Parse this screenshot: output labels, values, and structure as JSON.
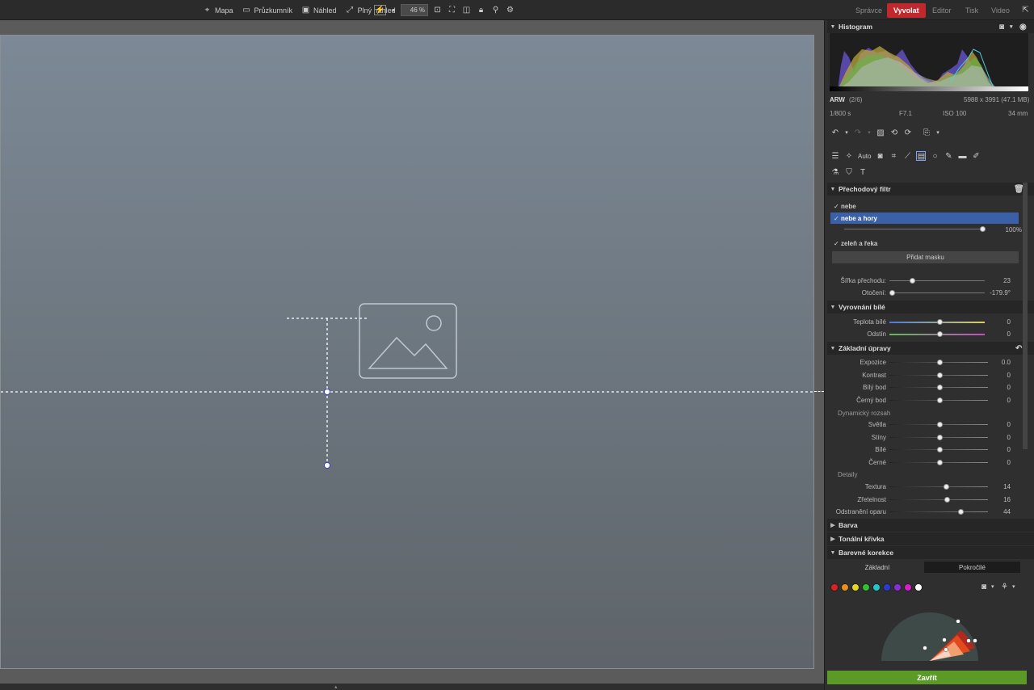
{
  "topbar": {
    "map": "Mapa",
    "browser": "Průzkumník",
    "preview": "Náhled",
    "fullscreen": "Plný náhled",
    "zoom": "46 %",
    "modules": [
      "Správce",
      "Vyvolat",
      "Editor",
      "Tisk",
      "Video"
    ],
    "active_module": "Vyvolat",
    "accent_color": "#c0282d"
  },
  "histogram": {
    "title": "Histogram",
    "format": "ARW",
    "index": "(2/6)",
    "dimensions": "5988 x 3991 (47.1 MB)",
    "shutter": "1/800 s",
    "aperture": "F7.1",
    "iso": "ISO 100",
    "focal": "34 mm"
  },
  "toolbar": {
    "auto_label": "Auto"
  },
  "gradient_filter": {
    "title": "Přechodový filtr",
    "masks": [
      "nebe",
      "nebe a hory",
      "zeleň a řeka"
    ],
    "selected_mask": "nebe a hory",
    "opacity": "100%",
    "opacity_fraction": 1.0,
    "add_mask": "Přidat masku",
    "width_label": "Šířka přechodu:",
    "width_value": "23",
    "width_fraction": 0.23,
    "rotation_label": "Otočení:",
    "rotation_value": "-179.9°",
    "rotation_fraction": 0.0
  },
  "white_balance": {
    "title": "Vyrovnání bílé",
    "temp_label": "Teplota bílé",
    "temp_value": "0",
    "tint_label": "Odstín",
    "tint_value": "0"
  },
  "basic": {
    "title": "Základní úpravy",
    "sliders": [
      {
        "label": "Expozice",
        "value": "0.0",
        "pos": 0.5
      },
      {
        "label": "Kontrast",
        "value": "0",
        "pos": 0.5
      },
      {
        "label": "Bílý bod",
        "value": "0",
        "pos": 0.5
      },
      {
        "label": "Černý bod",
        "value": "0",
        "pos": 0.5
      }
    ],
    "dynamic_range_label": "Dynamický rozsah",
    "dynamic_sliders": [
      {
        "label": "Světla",
        "value": "0",
        "pos": 0.5
      },
      {
        "label": "Stíny",
        "value": "0",
        "pos": 0.5
      },
      {
        "label": "Bílé",
        "value": "0",
        "pos": 0.5
      },
      {
        "label": "Černé",
        "value": "0",
        "pos": 0.5
      }
    ],
    "details_label": "Detaily",
    "detail_sliders": [
      {
        "label": "Textura",
        "value": "14",
        "pos": 0.57
      },
      {
        "label": "Zřetelnost",
        "value": "16",
        "pos": 0.58
      },
      {
        "label": "Odstranění oparu",
        "value": "44",
        "pos": 0.72
      }
    ]
  },
  "collapsed_sections": [
    "Barva",
    "Tonální křivka"
  ],
  "color_correction": {
    "title": "Barevné korekce",
    "tab_basic": "Základní",
    "tab_advanced": "Pokročilé",
    "swatches": [
      "#e02020",
      "#e8901a",
      "#e6d61e",
      "#30c030",
      "#22c6c6",
      "#2a3ad8",
      "#8a2be2",
      "#d81ec8",
      "#ffffff"
    ]
  },
  "close_label": "Zavřít"
}
